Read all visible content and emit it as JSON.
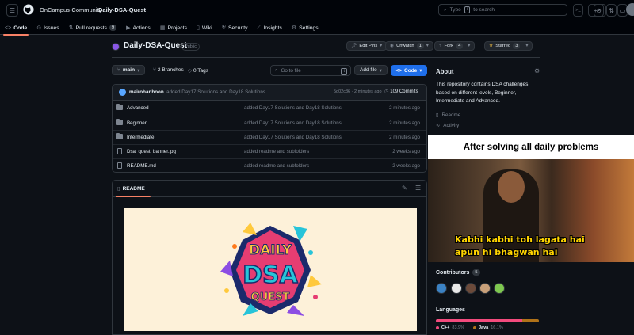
{
  "header": {
    "org": "OnCampus-Community",
    "separator": "/",
    "repo": "Daily-DSA-Quest",
    "search_placeholder_prefix": "Type",
    "search_key": "/",
    "search_placeholder_suffix": "to search",
    "prompt_glyph": ">_",
    "plus_glyph": "+"
  },
  "tabs": [
    {
      "icon": "<>",
      "label": "Code"
    },
    {
      "icon": "⊙",
      "label": "Issues"
    },
    {
      "icon": "⇅",
      "label": "Pull requests",
      "count": "9"
    },
    {
      "icon": "▶",
      "label": "Actions"
    },
    {
      "icon": "▦",
      "label": "Projects"
    },
    {
      "icon": "▯",
      "label": "Wiki"
    },
    {
      "icon": "⛨",
      "label": "Security"
    },
    {
      "icon": "⟋",
      "label": "Insights"
    },
    {
      "icon": "⚙",
      "label": "Settings"
    }
  ],
  "repo": {
    "name": "Daily-DSA-Quest",
    "visibility": "Public",
    "edit_pins": "Edit Pins",
    "unwatch": "Unwatch",
    "unwatch_count": "1",
    "fork": "Fork",
    "fork_count": "4",
    "starred": "Starred",
    "star_count": "3"
  },
  "toolbar": {
    "branch": "main",
    "branches": "2 Branches",
    "tags": "0 Tags",
    "goto_placeholder": "Go to file",
    "goto_key": "t",
    "add_file": "Add file",
    "code": "Code"
  },
  "commit": {
    "author": "mairohanhoon",
    "message": "added Day17 Solutions and Day18 Solutions",
    "sha_time": "5d02c86 · 2 minutes ago",
    "commits": "109 Commits"
  },
  "files": [
    {
      "type": "folder",
      "name": "Advanced",
      "message": "added Day17 Solutions and Day18 Solutions",
      "time": "2 minutes ago"
    },
    {
      "type": "folder",
      "name": "Beginner",
      "message": "added Day17 Solutions and Day18 Solutions",
      "time": "2 minutes ago"
    },
    {
      "type": "folder",
      "name": "Intermediate",
      "message": "added Day17 Solutions and Day18 Solutions",
      "time": "2 minutes ago"
    },
    {
      "type": "file",
      "name": "Dsa_quest_banner.jpg",
      "message": "added readme and subfolders",
      "time": "2 weeks ago"
    },
    {
      "type": "file",
      "name": "README.md",
      "message": "added readme and subfolders",
      "time": "2 weeks ago"
    }
  ],
  "readme": {
    "label": "README",
    "banner_line1": "DAILY",
    "banner_line2": "DSA",
    "banner_line3": "QUEST"
  },
  "sidebar": {
    "about_title": "About",
    "description": "This repository contains DSA challenges based on different levels, Beginner, Intermediate and Advanced.",
    "readme_link": "Readme",
    "activity_link": "Activity",
    "contributors_title": "Contributors",
    "contributors_count": "5",
    "languages_title": "Languages",
    "languages": [
      {
        "name": "C++",
        "percent": "83.9%",
        "color": "#f34b7d",
        "share": 83.9
      },
      {
        "name": "Java",
        "percent": "16.1%",
        "color": "#b07219",
        "share": 16.1
      }
    ]
  },
  "meme": {
    "top_text": "After solving all daily problems",
    "caption_line1": "Kabhi kabhi toh lagata hai",
    "caption_line2": "apun hi bhagwan hai"
  },
  "colors": {
    "accent": "#1f6feb",
    "tab_underline": "#f78166",
    "background": "#0d1117"
  }
}
